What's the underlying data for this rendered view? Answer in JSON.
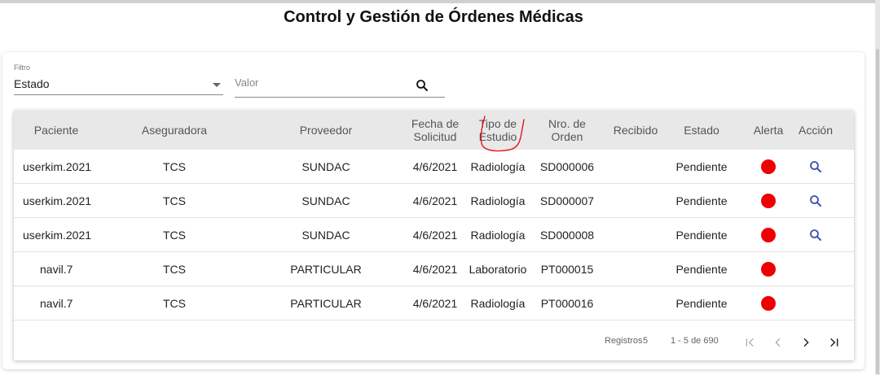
{
  "page": {
    "title": "Control y Gestión de Órdenes Médicas"
  },
  "filter": {
    "label": "Filtro",
    "selected": "Estado",
    "value_placeholder": "Valor"
  },
  "table": {
    "headers": {
      "paciente": "Paciente",
      "aseguradora": "Aseguradora",
      "proveedor": "Proveedor",
      "fecha_1": "Fecha de",
      "fecha_2": "Solicitud",
      "tipo_1": "Tipo de",
      "tipo_2": "Estudio",
      "nro_1": "Nro. de",
      "nro_2": "Orden",
      "recibido": "Recibido",
      "estado": "Estado",
      "alerta": "Alerta",
      "accion": "Acción"
    },
    "rows": [
      {
        "paciente": "userkim.2021",
        "aseguradora": "TCS",
        "proveedor": "SUNDAC",
        "fecha": "4/6/2021",
        "tipo": "Radiología",
        "nro": "SD000006",
        "recibido": "",
        "estado": "Pendiente",
        "alerta": "red",
        "accion_icon": "search-icon"
      },
      {
        "paciente": "userkim.2021",
        "aseguradora": "TCS",
        "proveedor": "SUNDAC",
        "fecha": "4/6/2021",
        "tipo": "Radiología",
        "nro": "SD000007",
        "recibido": "",
        "estado": "Pendiente",
        "alerta": "red",
        "accion_icon": "search-icon"
      },
      {
        "paciente": "userkim.2021",
        "aseguradora": "TCS",
        "proveedor": "SUNDAC",
        "fecha": "4/6/2021",
        "tipo": "Radiología",
        "nro": "SD000008",
        "recibido": "",
        "estado": "Pendiente",
        "alerta": "red",
        "accion_icon": "search-icon"
      },
      {
        "paciente": "navil.7",
        "aseguradora": "TCS",
        "proveedor": "PARTICULAR",
        "fecha": "4/6/2021",
        "tipo": "Laboratorio",
        "nro": "PT000015",
        "recibido": "",
        "estado": "Pendiente",
        "alerta": "red",
        "accion_icon": ""
      },
      {
        "paciente": "navil.7",
        "aseguradora": "TCS",
        "proveedor": "PARTICULAR",
        "fecha": "4/6/2021",
        "tipo": "Radiología",
        "nro": "PT000016",
        "recibido": "",
        "estado": "Pendiente",
        "alerta": "red",
        "accion_icon": ""
      }
    ]
  },
  "paginator": {
    "page_size_label": "Registros",
    "page_size": "5",
    "range": "1 - 5 de 690",
    "buttons": [
      "first-page-icon",
      "previous-page-icon",
      "next-page-icon",
      "last-page-icon"
    ]
  },
  "colors": {
    "alert_red": "#ef0000",
    "action_blue": "#3f51b5",
    "header_bg": "#e8e8e8",
    "annotation_red": "#e8121e"
  }
}
